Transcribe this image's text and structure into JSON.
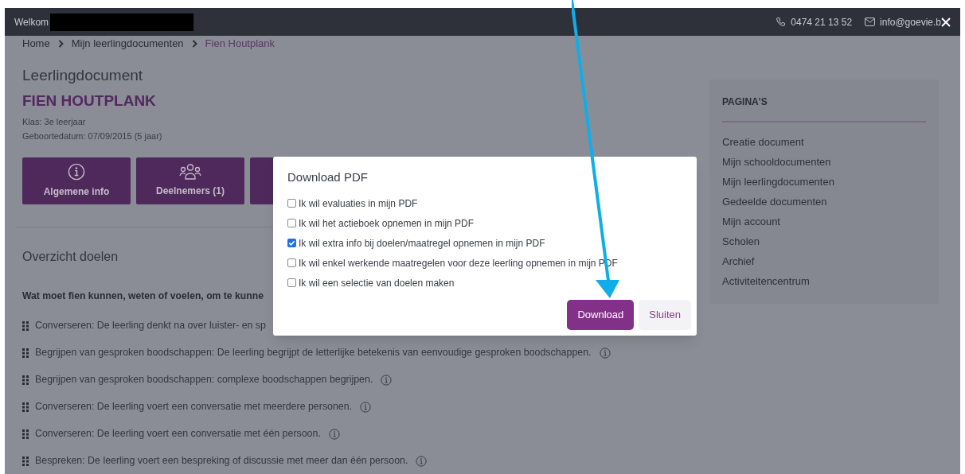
{
  "top_bar": {
    "welcome": "Welkom",
    "phone": "0474 21 13 52",
    "email": "info@goevie.b"
  },
  "breadcrumb": [
    {
      "label": "Home",
      "current": false
    },
    {
      "label": "Mijn leerlingdocumenten",
      "current": false
    },
    {
      "label": "Fien Houtplank",
      "current": true
    }
  ],
  "document": {
    "heading": "Leerlingdocument",
    "name": "FIEN HOUTPLANK",
    "class": "Klas: 3e leerjaar",
    "birth": "Geboortedatum: 07/09/2015 (5 jaar)"
  },
  "tiles": [
    {
      "kind": "info",
      "label": "Algemene info"
    },
    {
      "kind": "people",
      "label": "Deelnemers (1)"
    },
    {
      "kind": "hidden"
    }
  ],
  "goals": {
    "title": "Overzicht doelen",
    "question": "**Wat moet fien kunnen, weten of voelen, om te kunne**",
    "items": [
      {
        "text": "Converseren: De leerling denkt na over luister- en sp",
        "info": false
      },
      {
        "text": "Begrijpen van gesproken boodschappen: De leerling begrijpt de letterlijke betekenis van eenvoudige gesproken boodschappen.",
        "info": true
      },
      {
        "text": "Begrijpen van gesproken boodschappen: complexe boodschappen begrijpen.",
        "info": true
      },
      {
        "text": "Converseren: De leerling voert een conversatie met meerdere personen.",
        "info": true
      },
      {
        "text": "Converseren: De leerling voert een conversatie met één persoon.",
        "info": true
      },
      {
        "text": "Bespreken: De leerling voert een bespreking of discussie met meer dan één persoon.",
        "info": true
      }
    ]
  },
  "sidebar": {
    "title": "PAGINA'S",
    "items": [
      "Creatie document",
      "Mijn schooldocumenten",
      "Mijn leerlingdocumenten",
      "Gedeelde documenten",
      "Mijn account",
      "Scholen",
      "Archief",
      "Activiteitencentrum"
    ]
  },
  "dialog": {
    "title": "Download PDF",
    "options": [
      {
        "label": "Ik wil evaluaties in mijn PDF",
        "checked": false
      },
      {
        "label": "Ik wil het actieboek opnemen in mijn PDF",
        "checked": false
      },
      {
        "label": "Ik wil extra info bij doelen/maatregel opnemen in mijn PDF",
        "checked": true
      },
      {
        "label": "Ik wil enkel werkende maatregelen voor deze leerling opnemen in mijn PDF",
        "checked": false
      },
      {
        "label": "Ik wil een selectie van doelen maken",
        "checked": false
      }
    ],
    "primary": "Download",
    "secondary": "Sluiten"
  }
}
